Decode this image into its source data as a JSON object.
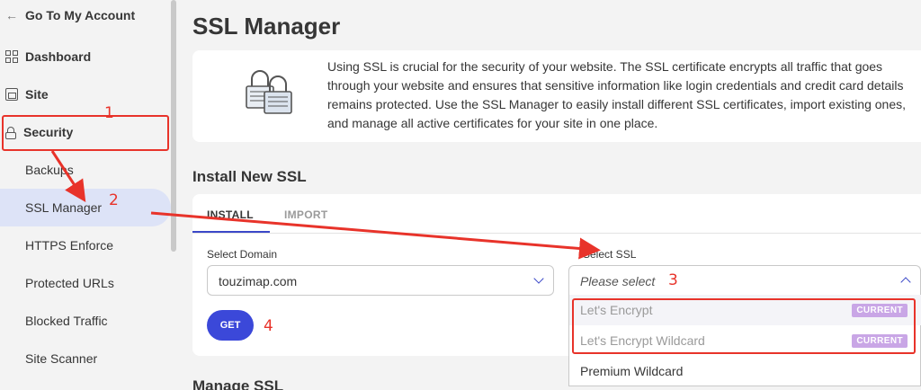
{
  "sidebar": {
    "back_label": "Go To My Account",
    "main_items": [
      {
        "label": "Dashboard",
        "icon": "dashboard-icon"
      },
      {
        "label": "Site",
        "icon": "site-icon"
      },
      {
        "label": "Security",
        "icon": "lock-icon"
      }
    ],
    "sub_items": [
      {
        "label": "Backups"
      },
      {
        "label": "SSL Manager",
        "active": true
      },
      {
        "label": "HTTPS Enforce"
      },
      {
        "label": "Protected URLs"
      },
      {
        "label": "Blocked Traffic"
      },
      {
        "label": "Site Scanner"
      }
    ]
  },
  "main": {
    "title": "SSL Manager",
    "info_text": "Using SSL is crucial for the security of your website. The SSL certificate encrypts all traffic that goes through your website and ensures that sensitive information like login credentials and credit card details remains protected. Use the SSL Manager to easily install different SSL certificates, import existing ones, and manage all active certificates for your site in one place.",
    "install_title": "Install New SSL",
    "tabs": [
      {
        "label": "INSTALL",
        "active": true
      },
      {
        "label": "IMPORT"
      }
    ],
    "domain_label": "Select Domain",
    "domain_value": "touzimap.com",
    "ssl_label": "Select SSL",
    "ssl_placeholder": "Please select",
    "get_label": "GET",
    "ssl_options": [
      {
        "label": "Let's Encrypt",
        "badge": "CURRENT",
        "disabled": true
      },
      {
        "label": "Let's Encrypt Wildcard",
        "badge": "CURRENT",
        "disabled": true
      },
      {
        "label": "Premium Wildcard",
        "disabled": false
      }
    ],
    "manage_title": "Manage SSL"
  },
  "annotations": {
    "n1": "1",
    "n2": "2",
    "n3": "3",
    "n4": "4"
  },
  "colors": {
    "accent": "#3b48d9",
    "annotation": "#e8332a",
    "badge": "#c9a6e6",
    "active_bg": "#dde3f7"
  }
}
